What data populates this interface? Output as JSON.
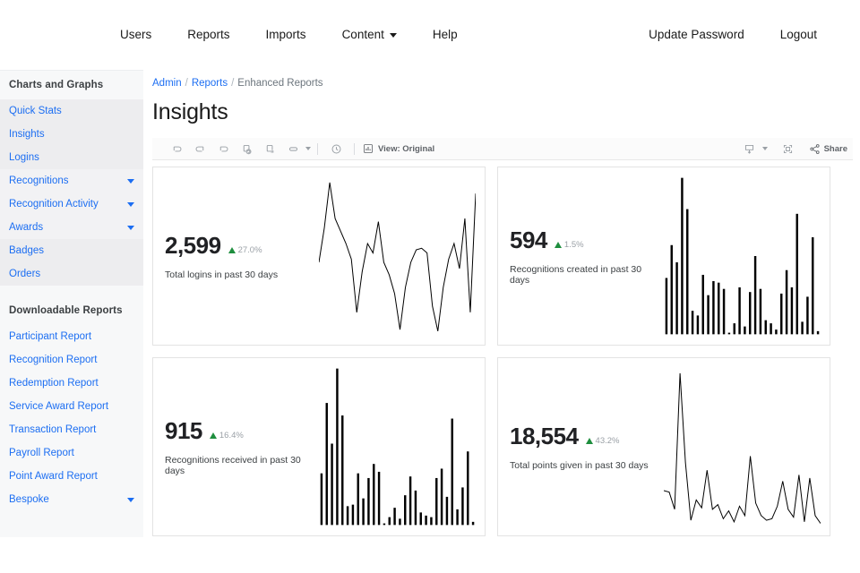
{
  "topnav": {
    "left_items": [
      {
        "label": "Users",
        "dropdown": false
      },
      {
        "label": "Reports",
        "dropdown": false
      },
      {
        "label": "Imports",
        "dropdown": false
      },
      {
        "label": "Content",
        "dropdown": true
      },
      {
        "label": "Help",
        "dropdown": false
      }
    ],
    "right_items": [
      {
        "label": "Update Password"
      },
      {
        "label": "Logout"
      }
    ]
  },
  "sidebar": {
    "section1_title": "Charts and Graphs",
    "section1_items": [
      {
        "label": "Quick Stats",
        "expandable": false
      },
      {
        "label": "Insights",
        "expandable": false
      },
      {
        "label": "Logins",
        "expandable": false
      },
      {
        "label": "Recognitions",
        "expandable": true
      },
      {
        "label": "Recognition Activity",
        "expandable": true
      },
      {
        "label": "Awards",
        "expandable": true
      },
      {
        "label": "Badges",
        "expandable": false
      },
      {
        "label": "Orders",
        "expandable": false
      }
    ],
    "section2_title": "Downloadable Reports",
    "section2_items": [
      {
        "label": "Participant Report",
        "expandable": false
      },
      {
        "label": "Recognition Report",
        "expandable": false
      },
      {
        "label": "Redemption Report",
        "expandable": false
      },
      {
        "label": "Service Award Report",
        "expandable": false
      },
      {
        "label": "Transaction Report",
        "expandable": false
      },
      {
        "label": "Payroll Report",
        "expandable": false
      },
      {
        "label": "Point Award Report",
        "expandable": false
      },
      {
        "label": "Bespoke",
        "expandable": true
      }
    ]
  },
  "breadcrumb": {
    "admin": "Admin",
    "reports": "Reports",
    "current": "Enhanced Reports",
    "separator": "/"
  },
  "page_title": "Insights",
  "toolbar": {
    "icons": [
      {
        "name": "undo-icon"
      },
      {
        "name": "redo-icon"
      },
      {
        "name": "revert-icon"
      },
      {
        "name": "refresh-data-icon"
      },
      {
        "name": "pause-data-icon"
      },
      {
        "name": "pill-icon"
      }
    ],
    "clock_icon": "history-icon",
    "view_icon": "chart-view-icon",
    "view_label": "View: Original",
    "download_icon": "download-icon",
    "fullscreen_icon": "fullscreen-icon",
    "share_icon": "share-icon",
    "share_label": "Share",
    "accent_color": "#9aa0a6"
  },
  "colors": {
    "link": "#1c6ef2",
    "positive": "#1e8e3e",
    "muted": "#9aa0a6",
    "sidebar_bg": "#f7f8f9"
  },
  "chart_data": [
    {
      "id": "card1",
      "type": "line",
      "title": "Total logins in past 30 days",
      "value": "2,599",
      "delta": "27.0%",
      "delta_direction": "up",
      "xlabel": "",
      "ylabel": "",
      "x": [
        1,
        2,
        3,
        4,
        5,
        6,
        7,
        8,
        9,
        10,
        11,
        12,
        13,
        14,
        15,
        16,
        17,
        18,
        19,
        20,
        21,
        22,
        23,
        24,
        25,
        26,
        27,
        28,
        29,
        30
      ],
      "values": [
        46,
        68,
        97,
        74,
        66,
        58,
        48,
        14,
        40,
        58,
        52,
        72,
        46,
        38,
        26,
        3,
        30,
        46,
        54,
        55,
        52,
        18,
        2,
        30,
        48,
        58,
        42,
        74,
        14,
        90
      ],
      "ylim": [
        0,
        100
      ]
    },
    {
      "id": "card2",
      "type": "bar",
      "title": "Recognitions created in past 30 days",
      "value": "594",
      "delta": "1.5%",
      "delta_direction": "up",
      "xlabel": "",
      "ylabel": "",
      "categories": [
        1,
        2,
        3,
        4,
        5,
        6,
        7,
        8,
        9,
        10,
        11,
        12,
        13,
        14,
        15,
        16,
        17,
        18,
        19,
        20,
        21,
        22,
        23,
        24,
        25,
        26,
        27,
        28,
        29,
        30
      ],
      "values": [
        36,
        57,
        46,
        100,
        80,
        15,
        12,
        38,
        25,
        34,
        33,
        29,
        1,
        7,
        30,
        5,
        27,
        50,
        29,
        9,
        7,
        3,
        26,
        41,
        30,
        77,
        8,
        24,
        62,
        2
      ],
      "ylim": [
        0,
        100
      ]
    },
    {
      "id": "card3",
      "type": "bar",
      "title": "Recognitions received in past 30 days",
      "value": "915",
      "delta": "16.4%",
      "delta_direction": "up",
      "xlabel": "",
      "ylabel": "",
      "categories": [
        1,
        2,
        3,
        4,
        5,
        6,
        7,
        8,
        9,
        10,
        11,
        12,
        13,
        14,
        15,
        16,
        17,
        18,
        19,
        20,
        21,
        22,
        23,
        24,
        25,
        26,
        27,
        28,
        29,
        30
      ],
      "values": [
        33,
        78,
        52,
        100,
        70,
        12,
        13,
        33,
        17,
        30,
        39,
        34,
        1,
        5,
        11,
        4,
        19,
        31,
        22,
        8,
        6,
        5,
        30,
        36,
        18,
        68,
        10,
        24,
        47,
        2
      ],
      "ylim": [
        0,
        100
      ]
    },
    {
      "id": "card4",
      "type": "line",
      "title": "Total points given in past 30 days",
      "value": "18,554",
      "delta": "43.2%",
      "delta_direction": "up",
      "xlabel": "",
      "ylabel": "",
      "x": [
        1,
        2,
        3,
        4,
        5,
        6,
        7,
        8,
        9,
        10,
        11,
        12,
        13,
        14,
        15,
        16,
        17,
        18,
        19,
        20,
        21,
        22,
        23,
        24,
        25,
        26,
        27,
        28,
        29,
        30
      ],
      "values": [
        22,
        21,
        10,
        97,
        40,
        3,
        16,
        11,
        35,
        10,
        13,
        4,
        9,
        2,
        12,
        6,
        44,
        14,
        6,
        3,
        4,
        12,
        28,
        10,
        5,
        32,
        2,
        30,
        6,
        1
      ],
      "ylim": [
        0,
        100
      ]
    }
  ]
}
